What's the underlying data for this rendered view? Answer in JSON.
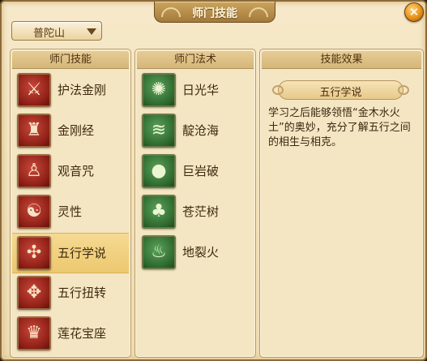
{
  "window": {
    "title": "师门技能",
    "close_label": "✕"
  },
  "dropdown": {
    "value": "普陀山"
  },
  "skills_panel": {
    "header": "师门技能",
    "items": [
      {
        "label": "护法金刚",
        "icon": "guardian-icon",
        "glyph": "⚔"
      },
      {
        "label": "金刚经",
        "icon": "scripture-icon",
        "glyph": "♜"
      },
      {
        "label": "观音咒",
        "icon": "guanyin-icon",
        "glyph": "♙"
      },
      {
        "label": "灵性",
        "icon": "spirit-head-icon",
        "glyph": "☯"
      },
      {
        "label": "五行学说",
        "icon": "five-elements-icon",
        "glyph": "✣",
        "selected": true
      },
      {
        "label": "五行扭转",
        "icon": "five-elements-twist-icon",
        "glyph": "✥"
      },
      {
        "label": "莲花宝座",
        "icon": "lotus-throne-icon",
        "glyph": "♛"
      }
    ]
  },
  "spells_panel": {
    "header": "师门法术",
    "items": [
      {
        "label": "日光华",
        "icon": "sunlight-icon",
        "glyph": "✺"
      },
      {
        "label": "靛沧海",
        "icon": "ocean-wave-icon",
        "glyph": "≋"
      },
      {
        "label": "巨岩破",
        "icon": "boulder-icon",
        "glyph": "●"
      },
      {
        "label": "苍茫树",
        "icon": "tree-icon",
        "glyph": "♣"
      },
      {
        "label": "地裂火",
        "icon": "fire-icon",
        "glyph": "♨"
      }
    ]
  },
  "effect_panel": {
    "header": "技能效果",
    "title": "五行学说",
    "description": "学习之后能够领悟“金木水火土”的奥妙，充分了解五行之间的相生与相克。"
  }
}
